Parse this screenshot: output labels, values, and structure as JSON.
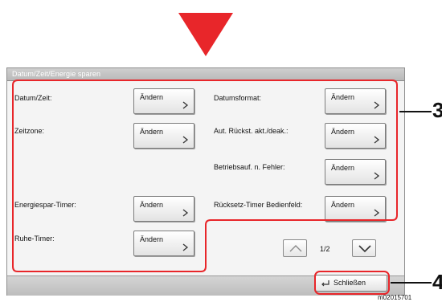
{
  "window_title": "Datum/Zeit/Energie sparen",
  "settings": [
    {
      "label": "Datum/Zeit:",
      "button": "Ändern"
    },
    {
      "label": "Datumsformat:",
      "button": "Ändern"
    },
    {
      "label": "Zeitzone:",
      "button": "Ändern"
    },
    {
      "label": "Aut. Rückst. akt./deak.:",
      "button": "Ändern"
    },
    {
      "label": "Betriebsauf. n. Fehler:",
      "button": "Ändern"
    },
    {
      "label": "Energiespar-Timer:",
      "button": "Ändern"
    },
    {
      "label": "Rücksetz-Timer Bedienfeld:",
      "button": "Ändern"
    },
    {
      "label": "Ruhe-Timer:",
      "button": "Ändern"
    }
  ],
  "pagination": {
    "indicator": "1/2"
  },
  "close_button": "Schließen",
  "callouts": {
    "settings_area": "3",
    "close": "4"
  },
  "image_code": "m02015701",
  "colors": {
    "highlight": "#e8262a",
    "arrow": "#e8262a"
  },
  "icons": [
    "arrow-down-icon",
    "chevron-right-icon",
    "chevron-up-icon",
    "chevron-down-icon",
    "return-icon"
  ]
}
